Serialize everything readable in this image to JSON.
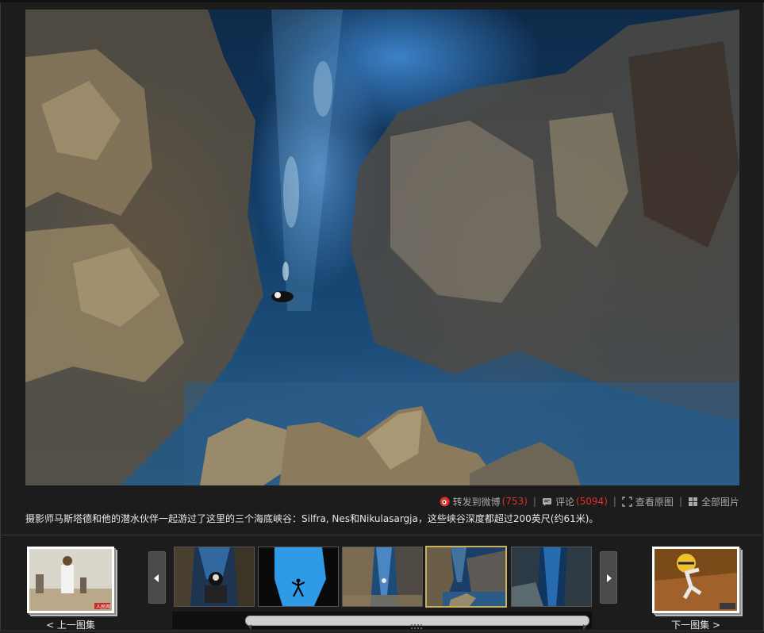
{
  "actions": {
    "forward_weibo": {
      "label": "转发到微博",
      "count": "(753)"
    },
    "comments": {
      "label": "评论",
      "count": "(5094)"
    },
    "view_original": {
      "label": "查看原图"
    },
    "all_pictures": {
      "label": "全部图片"
    },
    "separator": "|"
  },
  "caption": "摄影师马斯塔德和他的潜水伙伴一起游过了这里的三个海底峡谷：Silfra, Nes和Nikulasargja，这些峡谷深度都超过200英尺(约61米)。",
  "prev_album": {
    "label": "< 上一图集",
    "badge": "人民网"
  },
  "next_album": {
    "label": "下一图集 >"
  },
  "thumbnails": {
    "count": 5,
    "selected_index": 3
  },
  "icons": {
    "weibo": "weibo-icon",
    "comment": "comment-icon",
    "expand": "expand-icon",
    "grid": "grid-icon",
    "arrow_left": "arrow-left-icon",
    "arrow_right": "arrow-right-icon",
    "scroll_grip": "grip-icon"
  },
  "colors": {
    "count_red": "#e0302a",
    "selected_border": "#c8b060"
  }
}
